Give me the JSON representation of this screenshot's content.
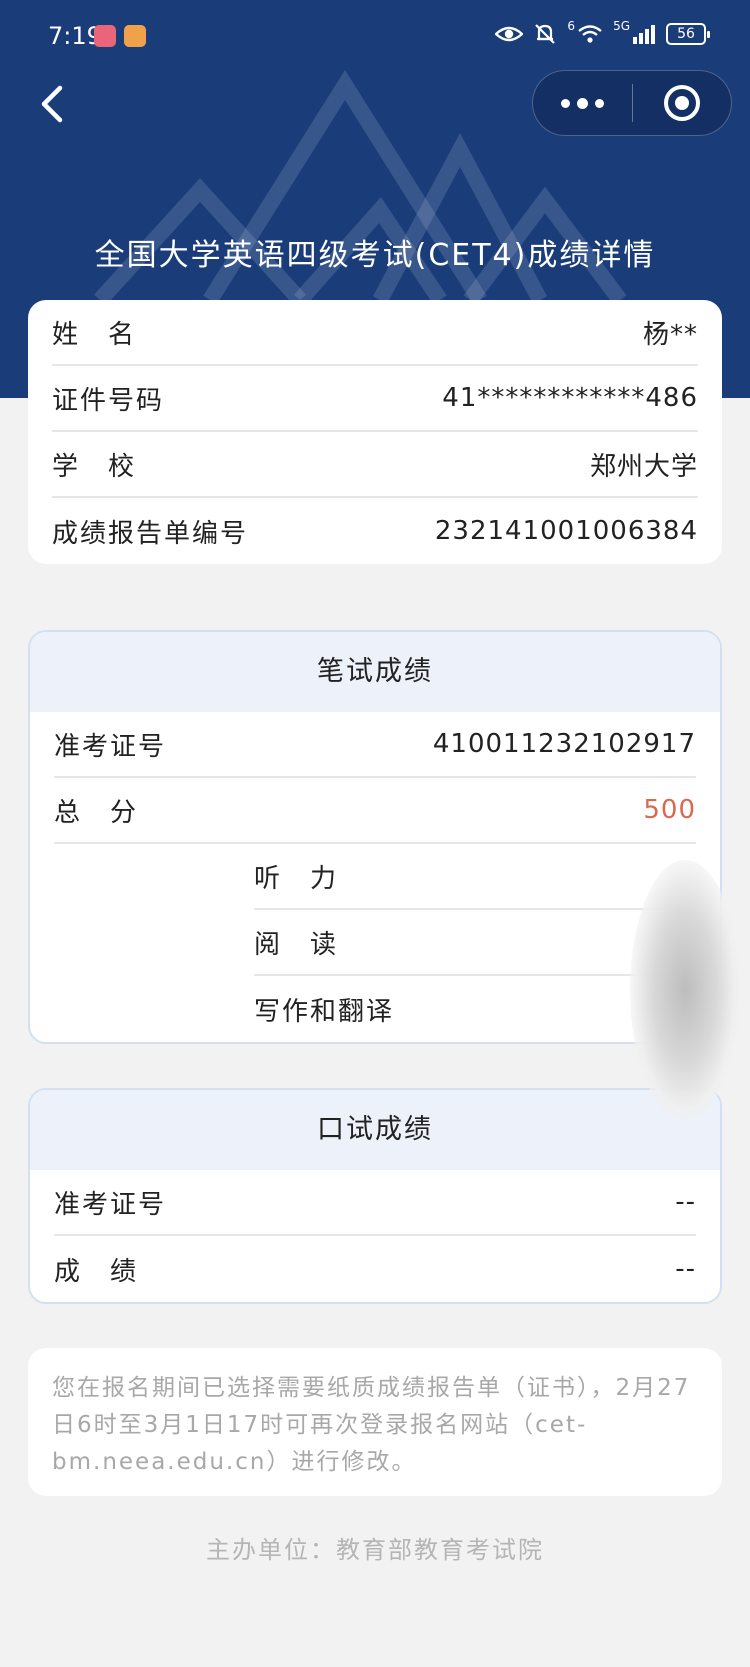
{
  "status_bar": {
    "time": "7:19",
    "signal_label": "5G",
    "wifi_label": "6",
    "battery": "56"
  },
  "nav": {
    "title": "全国大学英语四级考试(CET4)成绩详情"
  },
  "colors": {
    "header_bg": "#1a3d7a",
    "score_highlight": "#d9694f",
    "section_header_bg": "#edf1fa"
  },
  "personal_info": {
    "rows": [
      {
        "label": "姓　名",
        "value": "杨**"
      },
      {
        "label": "证件号码",
        "value": "41************486"
      },
      {
        "label": "学　校",
        "value": "郑州大学"
      },
      {
        "label": "成绩报告单编号",
        "value": "232141001006384"
      }
    ]
  },
  "written_exam": {
    "title": "笔试成绩",
    "admission_label": "准考证号",
    "admission_value": "410011232102917",
    "total_label": "总　分",
    "total_value": "500",
    "sub_rows": [
      {
        "label": "听　力",
        "value": ""
      },
      {
        "label": "阅　读",
        "value": ""
      },
      {
        "label": "写作和翻译",
        "value": ""
      }
    ]
  },
  "oral_exam": {
    "title": "口试成绩",
    "admission_label": "准考证号",
    "admission_value": "--",
    "score_label": "成　绩",
    "score_value": "--"
  },
  "notice": {
    "text": "您在报名期间已选择需要纸质成绩报告单（证书），2月27日6时至3月1日17时可再次登录报名网站（cet-bm.neea.edu.cn）进行修改。"
  },
  "footer": {
    "text": "主办单位：教育部教育考试院"
  }
}
